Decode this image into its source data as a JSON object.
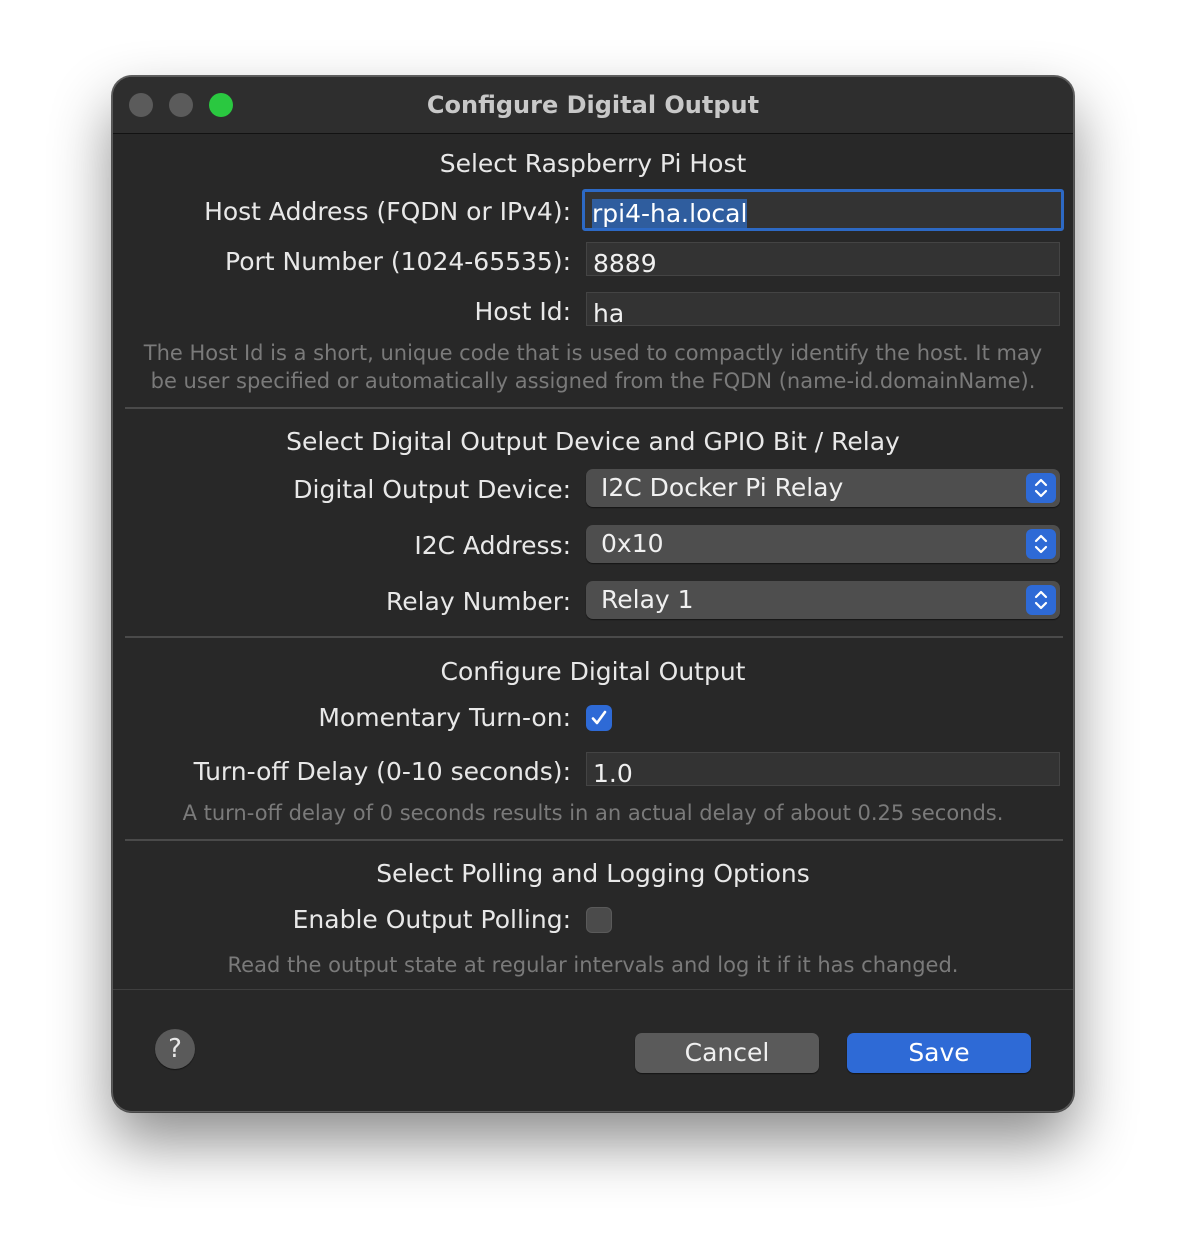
{
  "window": {
    "title": "Configure Digital Output"
  },
  "host_section": {
    "title": "Select Raspberry Pi Host",
    "host_address_label": "Host Address (FQDN or IPv4):",
    "host_address_value": "rpi4-ha.local",
    "port_label": "Port Number (1024-65535):",
    "port_value": "8889",
    "host_id_label": "Host Id:",
    "host_id_value": "ha",
    "help_line1": "The Host Id is a short, unique code that is used to compactly identify the host.  It may",
    "help_line2": "be user specified or automatically assigned from the FQDN (name-id.domainName)."
  },
  "device_section": {
    "title": "Select Digital Output Device and GPIO Bit / Relay",
    "device_label": "Digital Output Device:",
    "device_value": "I2C Docker Pi Relay",
    "i2c_label": "I2C Address:",
    "i2c_value": "0x10",
    "relay_label": "Relay Number:",
    "relay_value": "Relay 1"
  },
  "output_section": {
    "title": "Configure Digital Output",
    "momentary_label": "Momentary Turn-on:",
    "momentary_checked": true,
    "delay_label": "Turn-off Delay (0-10 seconds):",
    "delay_value": "1.0",
    "help": "A turn-off delay of 0 seconds results in an actual delay of about 0.25 seconds."
  },
  "polling_section": {
    "title": "Select Polling and Logging Options",
    "polling_label": "Enable Output Polling:",
    "polling_checked": false,
    "help": "Read the output state at regular intervals and log it if it has changed."
  },
  "footer": {
    "help_label": "?",
    "cancel_label": "Cancel",
    "save_label": "Save"
  },
  "colors": {
    "accent": "#2e6ad6",
    "window_bg": "#282828",
    "zoom_button": "#2ac840"
  }
}
